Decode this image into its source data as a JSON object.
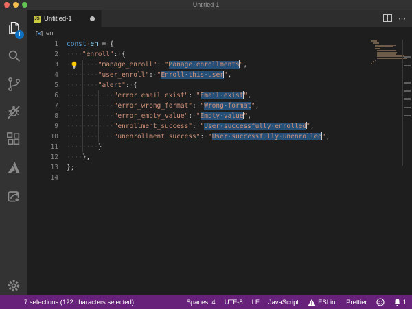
{
  "window": {
    "title": "Untitled-1"
  },
  "colors": {
    "status_bar": "#68217A",
    "badge": "#0E70C0",
    "selection": "#264F78",
    "editor_background": "#1E1E1E",
    "activity_bar": "#333333",
    "string": "#CE9178",
    "keyword": "#569CD6"
  },
  "activity_bar": {
    "badge": "1",
    "items": [
      {
        "name": "explorer",
        "active": true
      },
      {
        "name": "search",
        "active": false
      },
      {
        "name": "source-control",
        "active": false
      },
      {
        "name": "debug",
        "active": false
      },
      {
        "name": "extensions",
        "active": false
      },
      {
        "name": "azure",
        "active": false
      },
      {
        "name": "share-extension",
        "active": false
      }
    ],
    "manage": "settings-gear"
  },
  "tab": {
    "label": "Untitled-1",
    "file_icon": "JS",
    "modified": true
  },
  "breadcrumb": {
    "symbol": "en",
    "symbol_icon": "symbol-variable-icon"
  },
  "editor": {
    "lightbulb_line": 3,
    "selection_lines": [
      3,
      4,
      6,
      7,
      8,
      9,
      10
    ],
    "lines": [
      {
        "num": 1,
        "g": 0,
        "tk": [
          [
            "kw",
            "const"
          ],
          [
            "pln",
            " "
          ],
          [
            "var",
            "en"
          ],
          [
            "pln",
            " "
          ],
          [
            "op",
            "="
          ],
          [
            "pln",
            " "
          ],
          [
            "op",
            "{"
          ]
        ]
      },
      {
        "num": 2,
        "g": 1,
        "tk": [
          [
            "ind",
            "    "
          ],
          [
            "str",
            "\"enroll\""
          ],
          [
            "op",
            ":"
          ],
          [
            "pln",
            " "
          ],
          [
            "op",
            "{"
          ]
        ]
      },
      {
        "num": 3,
        "g": 2,
        "tk": [
          [
            "ind",
            "        "
          ],
          [
            "str",
            "\"manage_enroll\""
          ],
          [
            "op",
            ":"
          ],
          [
            "pln",
            " "
          ],
          [
            "str",
            "\""
          ],
          [
            "sel",
            "Manage enrollments"
          ],
          [
            "cur",
            ""
          ],
          [
            "str",
            "\""
          ],
          [
            "op",
            ","
          ]
        ]
      },
      {
        "num": 4,
        "g": 2,
        "tk": [
          [
            "ind",
            "        "
          ],
          [
            "str",
            "\"user_enroll\""
          ],
          [
            "op",
            ":"
          ],
          [
            "pln",
            " "
          ],
          [
            "str",
            "\""
          ],
          [
            "sel",
            "Enroll this user"
          ],
          [
            "cur",
            ""
          ],
          [
            "str",
            "\""
          ],
          [
            "op",
            ","
          ]
        ]
      },
      {
        "num": 5,
        "g": 2,
        "tk": [
          [
            "ind",
            "        "
          ],
          [
            "str",
            "\"alert\""
          ],
          [
            "op",
            ":"
          ],
          [
            "pln",
            " "
          ],
          [
            "op",
            "{"
          ]
        ]
      },
      {
        "num": 6,
        "g": 3,
        "tk": [
          [
            "ind",
            "            "
          ],
          [
            "str",
            "\"error_email_exist\""
          ],
          [
            "op",
            ":"
          ],
          [
            "pln",
            " "
          ],
          [
            "str",
            "\""
          ],
          [
            "sel",
            "Email exist"
          ],
          [
            "cur",
            ""
          ],
          [
            "str",
            "\""
          ],
          [
            "op",
            ","
          ]
        ]
      },
      {
        "num": 7,
        "g": 3,
        "tk": [
          [
            "ind",
            "            "
          ],
          [
            "str",
            "\"error_wrong_format\""
          ],
          [
            "op",
            ":"
          ],
          [
            "pln",
            " "
          ],
          [
            "str",
            "\""
          ],
          [
            "sel",
            "Wrong format"
          ],
          [
            "cur",
            ""
          ],
          [
            "str",
            "\""
          ],
          [
            "op",
            ","
          ]
        ]
      },
      {
        "num": 8,
        "g": 3,
        "tk": [
          [
            "ind",
            "            "
          ],
          [
            "str",
            "\"error_empty_value\""
          ],
          [
            "op",
            ":"
          ],
          [
            "pln",
            " "
          ],
          [
            "str",
            "\""
          ],
          [
            "sel",
            "Empty value"
          ],
          [
            "cur",
            ""
          ],
          [
            "str",
            "\""
          ],
          [
            "op",
            ","
          ]
        ]
      },
      {
        "num": 9,
        "g": 3,
        "tk": [
          [
            "ind",
            "            "
          ],
          [
            "str",
            "\"enrollment_success\""
          ],
          [
            "op",
            ":"
          ],
          [
            "pln",
            " "
          ],
          [
            "str",
            "\""
          ],
          [
            "sel",
            "User successfully enrolled"
          ],
          [
            "cur",
            ""
          ],
          [
            "str",
            "\""
          ],
          [
            "op",
            ","
          ]
        ]
      },
      {
        "num": 10,
        "g": 3,
        "tk": [
          [
            "ind",
            "            "
          ],
          [
            "str",
            "\"unenrollment_success\""
          ],
          [
            "op",
            ":"
          ],
          [
            "pln",
            " "
          ],
          [
            "str",
            "\""
          ],
          [
            "sel",
            "User successfully unenrolled"
          ],
          [
            "cur",
            ""
          ],
          [
            "str",
            "\""
          ],
          [
            "op",
            ","
          ]
        ]
      },
      {
        "num": 11,
        "g": 2,
        "tk": [
          [
            "ind",
            "        "
          ],
          [
            "op",
            "}"
          ]
        ]
      },
      {
        "num": 12,
        "g": 1,
        "tk": [
          [
            "ind",
            "    "
          ],
          [
            "op",
            "},"
          ]
        ]
      },
      {
        "num": 13,
        "g": 0,
        "tk": [
          [
            "op",
            "};"
          ]
        ]
      },
      {
        "num": 14,
        "g": 0,
        "tk": []
      }
    ]
  },
  "status_bar": {
    "left": "7 selections (122 characters selected)",
    "right": [
      {
        "name": "indentation",
        "label": "Spaces: 4"
      },
      {
        "name": "encoding",
        "label": "UTF-8"
      },
      {
        "name": "eol",
        "label": "LF"
      },
      {
        "name": "language-mode",
        "label": "JavaScript"
      },
      {
        "name": "eslint",
        "icon": "warning",
        "label": "ESLint"
      },
      {
        "name": "prettier",
        "label": "Prettier"
      },
      {
        "name": "feedback",
        "icon": "smiley",
        "label": ""
      },
      {
        "name": "notifications",
        "icon": "bell",
        "label": "1"
      }
    ]
  }
}
